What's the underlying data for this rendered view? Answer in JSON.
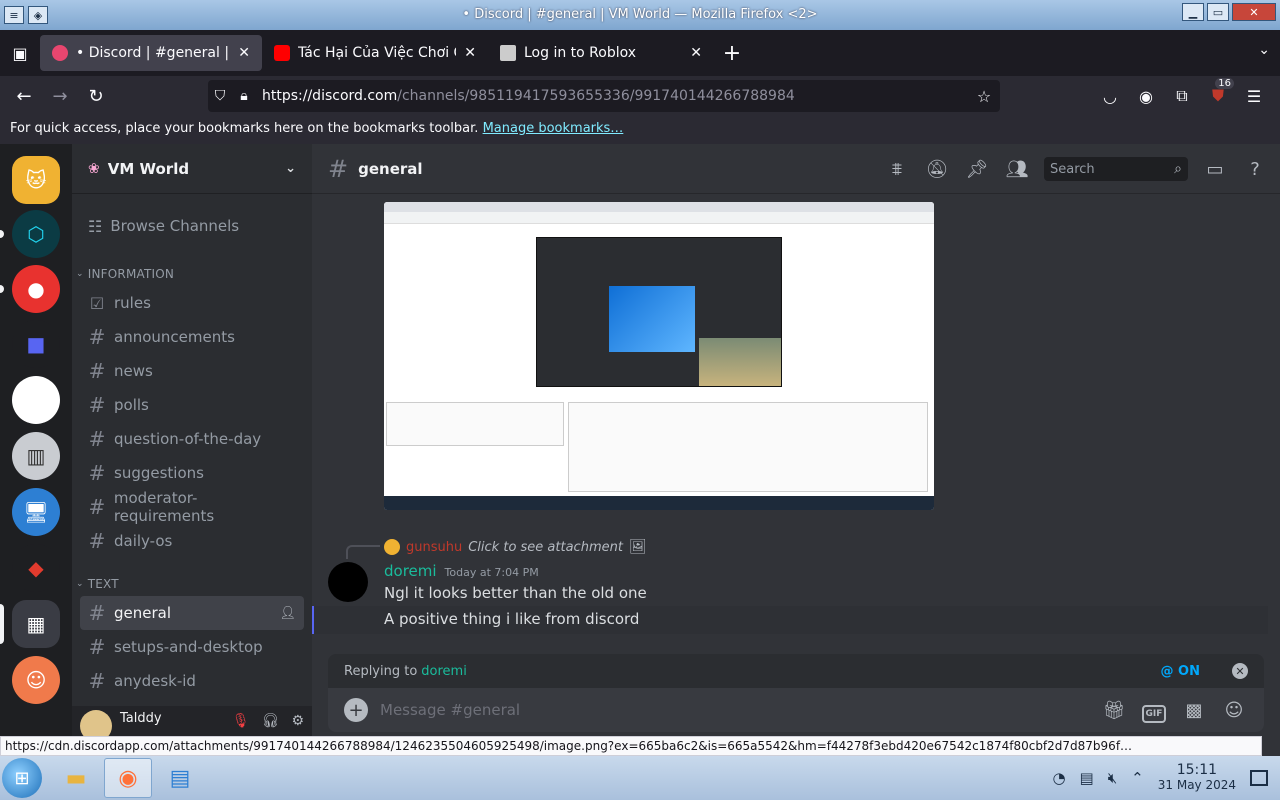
{
  "window": {
    "title": "• Discord | #general | VM World — Mozilla Firefox <2>",
    "buttons": [
      "▁",
      "▭",
      "✕"
    ]
  },
  "browser": {
    "tabs": [
      {
        "title": "• Discord | #general | VM World",
        "active": true,
        "favicon_color": "#e8466f"
      },
      {
        "title": "Tác Hại Của Việc Chơi Game",
        "active": false,
        "favicon_color": "#ff0000"
      },
      {
        "title": "Log in to Roblox",
        "active": false,
        "favicon_color": "#cccccc"
      }
    ],
    "tab_close_glyph": "✕",
    "new_tab_glyph": "+",
    "url_host": "https://discord.com",
    "url_path": "/channels/985119417593655336/991740144266788984",
    "extension_badge": "16",
    "bookmarks_text": "For quick access, place your bookmarks here on the bookmarks toolbar.",
    "bookmarks_link": "Manage bookmarks…",
    "status_url": "https://cdn.discordapp.com/attachments/991740144266788984/1246235504605925498/image.png?ex=665ba6c2&is=665a5542&hm=f44278f3ebd420e67542c1874f80cbf2d7d87b96f…"
  },
  "guilds": [
    {
      "name": "pet-server",
      "color": "#f0b232",
      "glyph": "🐱"
    },
    {
      "name": "shield-server",
      "color": "#0b3b44",
      "glyph": "⬡"
    },
    {
      "name": "red-server",
      "color": "#e8322f",
      "glyph": "●"
    },
    {
      "name": "folder",
      "color": "#1e1f22",
      "glyph": "■"
    },
    {
      "name": "white-server",
      "color": "#ffffff",
      "glyph": ""
    },
    {
      "name": "pillar-server",
      "color": "#c9ccd1",
      "glyph": "▥"
    },
    {
      "name": "ultraviewer-server",
      "color": "#2d7fd3",
      "glyph": "🖥"
    },
    {
      "name": "anydesk-server",
      "color": "#e23b2e",
      "glyph": "◆"
    },
    {
      "name": "vm-world-server",
      "color": "#3a3c44",
      "glyph": "▦"
    },
    {
      "name": "cartoon-server",
      "color": "#f07a4b",
      "glyph": "☺"
    }
  ],
  "sidebar": {
    "server_name": "VM World",
    "browse_label": "Browse Channels",
    "category_info": "INFORMATION",
    "info_channels": [
      "rules",
      "announcements",
      "news",
      "polls",
      "question-of-the-day",
      "suggestions",
      "moderator-requirements",
      "daily-os"
    ],
    "category_text": "TEXT",
    "text_channels": [
      "general",
      "setups-and-desktop",
      "anydesk-id"
    ],
    "active_channel": "general"
  },
  "user": {
    "name": "Talddy"
  },
  "chat": {
    "channel_name": "general",
    "search_placeholder": "Search",
    "reply_ref_author": "gunsuhu",
    "reply_ref_text": "Click to see attachment",
    "author": "doremi",
    "timestamp": "Today at 7:04 PM",
    "lines": [
      "Ngl it looks better than the old one",
      "A positive thing i like from discord"
    ],
    "replying_prefix": "Replying to",
    "replying_to": "doremi",
    "mention_toggle": "@ ON",
    "composer_placeholder": "Message #general",
    "gif_label": "GIF"
  },
  "taskbar": {
    "time": "15:11",
    "date": "31 May 2024"
  },
  "colors": {
    "accent": "#5865f2",
    "author": "#1abc9c",
    "link": "#00a8fc"
  }
}
